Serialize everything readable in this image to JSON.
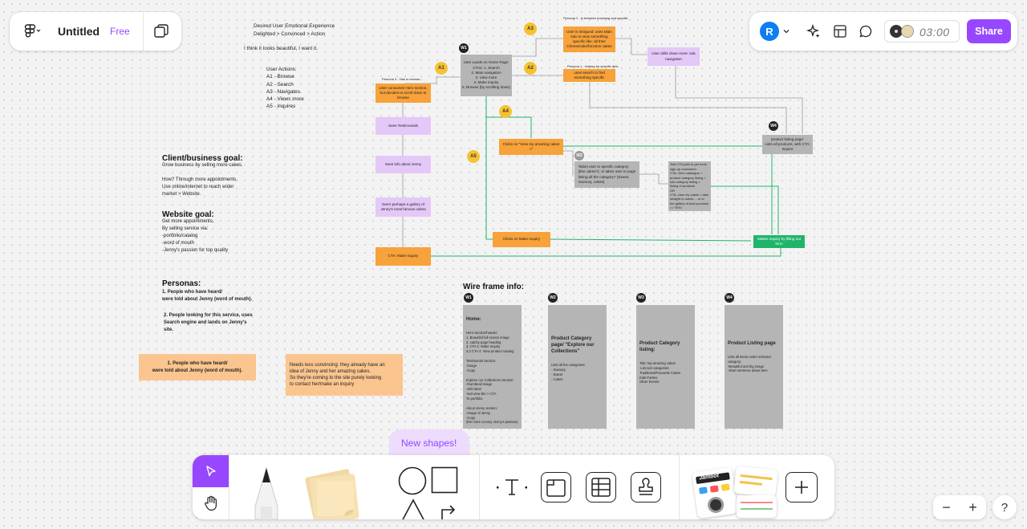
{
  "topbar": {
    "file_name": "Untitled",
    "plan_badge": "Free",
    "avatar_initial": "R",
    "timer": "03:00",
    "share_label": "Share"
  },
  "canvas": {
    "emotional": "Desired User Emotional Experience\nDelighted > Convinced > Action",
    "beautiful": "I think it looks beautiful, I want it.",
    "user_actions": "User Actions:\nA1 - Browse\nA2 - Search\nA3 - Navigates\nA4 - Views more\nA5 - Inquires",
    "client_goal_title": "Client/business goal:",
    "client_goal_body": "Grow business by selling more cakes.\n\nHow? Through more appointments.\nUse online/internet to reach wider\nmarket > Website.",
    "website_goal_title": "Website goal:",
    "website_goal_body": "Get more appointments,\nBy selling service via:\n   -portfolio/catalog\n   -word of mouth\n   -Jenny's passion for top quality",
    "personas_title": "Personas:",
    "persona1": "1.  People who have heard/\nwere told about Jenny (word of mouth).",
    "persona2": "2.  People looking for this service, uses\nSearch engine and lands on Jenny's\nsite.",
    "persona1_sticky": "1.  People who have heard/\nwere told about Jenny (word of mouth).",
    "persona1_note": "Needs less convincing: they already have an\nidea of Jenny and her amazing cakes.\nSo they're coming to the site purely looking\nto contact her/make an inquiry",
    "persona3_caption": "Persona 3 - Has to browse...",
    "persona2_caption": "Persona 2 - Is between browsing and specific",
    "persona1b_caption": "Persona 1 - looking for specific item,\nuses search to find something\nspecific",
    "wireframe_title": "Wire frame info:"
  },
  "flow": {
    "labels": [
      "A1",
      "A2",
      "A3",
      "A4",
      "A5",
      "W1",
      "W2",
      "W4"
    ],
    "landing": "User Lands on Home Page:\nCTAs: 1. Search\n2. Main navigation\n3. View more\n4. Make inquiry\n5. Browse (by scrolling down)",
    "browse_start": "User consumes Hero section, but decides to scroll down to browse",
    "testimonials": "Sees Testimonials",
    "info_jenny": "Sees info about Jenny",
    "gallery": "See's perhaps a gallery of Jenny's most famous cakes",
    "cta_inquiry": "CTA: Make Inquiry",
    "intrigued": "User is intrigued: uses Main Nav to view something specific like: all their Cheesecake/function cakes",
    "sub_nav": "User drills down more: sub navigation",
    "search_specific": "uses search to find something specific",
    "view_cakes": "Clicks on \"View my amazing cakes >\"",
    "takes_user": "Takes user to specific category\n(like cakes?), or takes user to page\nlisting all the category? (Sweet,\nSavoury, cakes)",
    "test_cta": "Test CTA path to get more sign-up customers:\nCTA: View catalogue > product category listing > sub category listing > listing of products\nOR\nCTA: view my cakes > take straight to cakes.... or to the gallery of best products >> YES!",
    "product_listing": "product listing page:\nLists all products, with CTA: Inquire",
    "click_inquiry": "Clicks on Make Inquiry",
    "make_inquiry_form": "Makes inquiry by filling out form"
  },
  "wireframes": [
    {
      "tag": "W1",
      "title": "Home:",
      "body": "Hero Section/header:\n1. Beautiful full screen image\n2. catchy page heading\n3. CTA 1: Make Inquiry\n3.2 CTA 2: View product catalog\n\nTestimonial Section:\n-Image\n-Copy\n\nExplore our Collections Section:\n-thumbnail image\n-with label\n-text view btn > CTA\nTo portfolio\n\nAbout Jenny section:\n-Image of Jenny\n-Copy\n(the more convey Jenny's passion)\n\nGallery..."
    },
    {
      "tag": "W2",
      "title": "Product Category page/ \"Explore our Collections\"",
      "body": "Lists all the categories:\n- Savoury\n- Sweet\n- Cakes"
    },
    {
      "tag": "W3",
      "title": "Product Category listing:",
      "body": "Title: My amazing cakes\n-List sub categories:\n  Traditional/Favourite Cakes\n  Kids Parties\n  Other Events"
    },
    {
      "tag": "W4",
      "title": "Product Listing page",
      "body": "Lists all items under selected category:\n-Beautiful and big image\n-short sentence about item"
    }
  ],
  "toolbar": {
    "new_shapes_label": "New shapes!",
    "tools": [
      "select-tool",
      "hand-tool",
      "pen-tool",
      "sticky-note-tool",
      "ellipse-tool",
      "rectangle-tool",
      "triangle-tool",
      "connector-tool",
      "text-tool",
      "section-tool",
      "table-tool",
      "stamp-tool",
      "widgets",
      "add-more"
    ],
    "widget_sticker_text": "Jambot"
  },
  "zoom": {
    "minus": "−",
    "plus": "+",
    "help": "?"
  },
  "colors": {
    "accent": "#9747ff",
    "orange": "#f7a23a",
    "purple_sticky": "#e4c8f8",
    "grey_sticky": "#b5b5b5",
    "green": "#1fb46a",
    "connector_green": "#1fb46a"
  }
}
